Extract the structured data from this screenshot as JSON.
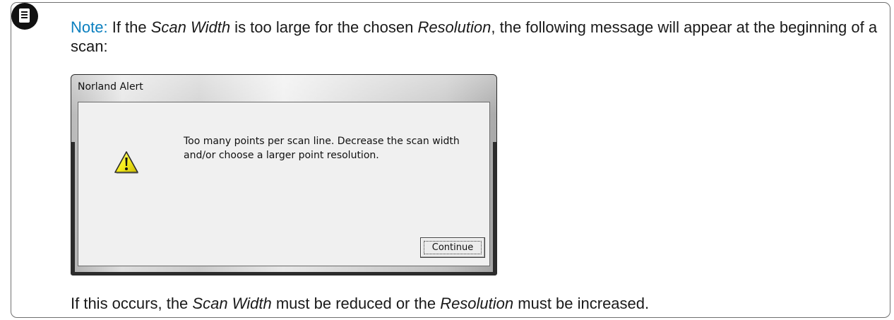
{
  "note": {
    "label": "Note:",
    "text_1": " If the ",
    "em_1": "Scan Width",
    "text_2": " is too large for the chosen ",
    "em_2": "Resolution",
    "text_3": ", the following message will appear at the beginning of a scan:"
  },
  "dialog": {
    "title": "Norland Alert",
    "message": "Too many points per scan line.  Decrease the scan width and/or choose a larger point resolution.",
    "button_label": "Continue"
  },
  "after": {
    "text_1": "If this occurs, the ",
    "em_1": "Scan Width",
    "text_2": " must be reduced or the ",
    "em_2": "Resolution",
    "text_3": " must be increased."
  },
  "colors": {
    "note_label": "#0a7fbf",
    "box_border": "#707070",
    "warning_yellow": "#f6ee1c"
  },
  "icons": {
    "note": "note-document-icon",
    "warning": "warning-triangle-icon"
  }
}
